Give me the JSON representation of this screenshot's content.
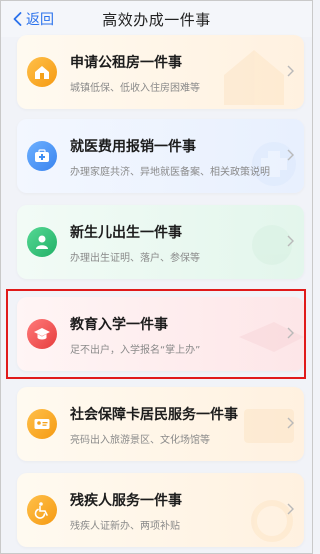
{
  "nav": {
    "back_label": "返回",
    "title": "高效办成一件事"
  },
  "colors": {
    "accent": "#2b72ec",
    "highlight_border": "#e01a1a"
  },
  "cards": [
    {
      "title": "申请公租房一件事",
      "subtitle": "城镇低保、低收入住房困难等",
      "icon": "house-icon",
      "icon_color": "#f5a21b"
    },
    {
      "title": "就医费用报销一件事",
      "subtitle": "办理家庭共济、异地就医备案、相关政策说明",
      "icon": "medical-kit-icon",
      "icon_color": "#3f8ef2"
    },
    {
      "title": "新生儿出生一件事",
      "subtitle": "办理出生证明、落户、参保等",
      "icon": "baby-icon",
      "icon_color": "#2fbd74"
    },
    {
      "title": "教育入学一件事",
      "subtitle": "足不出户，入学报名“掌上办”",
      "icon": "graduation-cap-icon",
      "icon_color": "#ee4f4f"
    },
    {
      "title": "社会保障卡居民服务一件事",
      "subtitle": "亮码出入旅游景区、文化场馆等",
      "icon": "id-card-icon",
      "icon_color": "#f5a21b"
    },
    {
      "title": "残疾人服务一件事",
      "subtitle": "残疾人证新办、两项补贴",
      "icon": "wheelchair-icon",
      "icon_color": "#f5a21b"
    }
  ]
}
